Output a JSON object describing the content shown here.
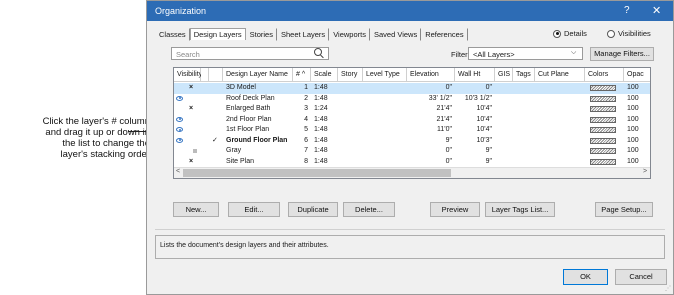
{
  "callout": {
    "lines": [
      "Click the layer's # column",
      "and drag it up or down in",
      "the list to change the",
      "layer's stacking order"
    ]
  },
  "dialog": {
    "title": "Organization",
    "help_glyph": "?",
    "close_glyph": "✕",
    "tabs": [
      "Classes",
      "Design Layers",
      "Stories",
      "Sheet Layers",
      "Viewports",
      "Saved Views",
      "References"
    ],
    "active_tab": "Design Layers",
    "view_mode": {
      "details_label": "Details",
      "visibilities_label": "Visibilities",
      "selected": "Details"
    },
    "search_placeholder": "Search",
    "filter_label": "Filter:",
    "filter_value": "<All Layers>",
    "manage_filters_label": "Manage Filters...",
    "columns": [
      "Visibility",
      "Design Layer Name",
      "#",
      "Scale",
      "Story",
      "Level Type",
      "Elevation",
      "Wall Ht",
      "GIS",
      "Tags",
      "Cut Plane",
      "Colors",
      "Opac"
    ],
    "rows": [
      {
        "vis": "x",
        "active": "",
        "name": "3D Model",
        "num": "1",
        "scale": "1:48",
        "elevation": "0\"",
        "wall_ht": "0\"",
        "opacity": "100",
        "bold": false,
        "selected": true
      },
      {
        "vis": "eye",
        "active": "",
        "name": "Roof Deck Plan",
        "num": "2",
        "scale": "1:48",
        "elevation": "33' 1/2\"",
        "wall_ht": "10'3 1/2\"",
        "opacity": "100",
        "bold": false,
        "selected": false
      },
      {
        "vis": "x",
        "active": "",
        "name": "Enlarged Bath",
        "num": "3",
        "scale": "1:24",
        "elevation": "21'4\"",
        "wall_ht": "10'4\"",
        "opacity": "100",
        "bold": false,
        "selected": false
      },
      {
        "vis": "eye",
        "active": "",
        "name": "2nd Floor Plan",
        "num": "4",
        "scale": "1:48",
        "elevation": "21'4\"",
        "wall_ht": "10'4\"",
        "opacity": "100",
        "bold": false,
        "selected": false
      },
      {
        "vis": "eye",
        "active": "",
        "name": "1st Floor Plan",
        "num": "5",
        "scale": "1:48",
        "elevation": "11'0\"",
        "wall_ht": "10'4\"",
        "opacity": "100",
        "bold": false,
        "selected": false
      },
      {
        "vis": "eye",
        "active": "✓",
        "name": "Ground Floor Plan",
        "num": "6",
        "scale": "1:48",
        "elevation": "9\"",
        "wall_ht": "10'3\"",
        "opacity": "100",
        "bold": true,
        "selected": false
      },
      {
        "vis": "grey",
        "active": "",
        "name": "Gray",
        "num": "7",
        "scale": "1:48",
        "elevation": "0\"",
        "wall_ht": "9\"",
        "opacity": "100",
        "bold": false,
        "selected": false
      },
      {
        "vis": "x",
        "active": "",
        "name": "Site Plan",
        "num": "8",
        "scale": "1:48",
        "elevation": "0\"",
        "wall_ht": "9\"",
        "opacity": "100",
        "bold": false,
        "selected": false
      }
    ],
    "buttons": [
      "New...",
      "Edit...",
      "Duplicate",
      "Delete...",
      "Preview",
      "Layer Tags List...",
      "Page Setup..."
    ],
    "description": "Lists the document's design layers and their attributes.",
    "ok_label": "OK",
    "cancel_label": "Cancel",
    "scroll_left_glyph": "<",
    "scroll_right_glyph": ">",
    "sort_glyph": "^"
  }
}
